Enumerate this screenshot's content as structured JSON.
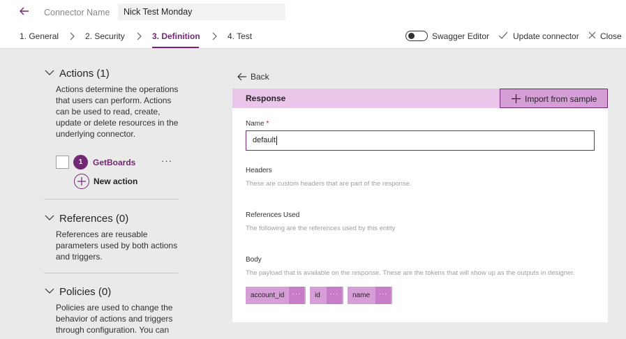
{
  "header": {
    "connector_label": "Connector Name",
    "connector_value": "Nick Test Monday"
  },
  "steps": [
    {
      "label": "1. General"
    },
    {
      "label": "2. Security"
    },
    {
      "label": "3. Definition"
    },
    {
      "label": "4. Test"
    }
  ],
  "toolbar": {
    "swagger_label": "Swagger Editor",
    "swagger_enabled": false,
    "update_label": "Update connector",
    "close_label": "Close"
  },
  "sidebar": {
    "actions": {
      "heading": "Actions (1)",
      "description": "Actions determine the operations that users can perform. Actions can be used to read, create, update or delete resources in the underlying connector.",
      "items": [
        {
          "number": "1",
          "name": "GetBoards",
          "more": "···"
        }
      ],
      "new_action_label": "New action"
    },
    "references": {
      "heading": "References (0)",
      "description": "References are reusable parameters used by both actions and triggers."
    },
    "policies": {
      "heading": "Policies (0)",
      "description": "Policies are used to change the behavior of actions and triggers through configuration. You can"
    }
  },
  "main": {
    "back_label": "Back",
    "card_title": "Response",
    "import_label": "Import from sample",
    "name_label": "Name",
    "required_mark": "*",
    "name_value": "default",
    "headers_label": "Headers",
    "headers_help": "These are custom headers that are part of the response.",
    "refs_label": "References Used",
    "refs_help": "The following are the references used by this entity",
    "body_label": "Body",
    "body_help": "The payload that is available on the response. These are the tokens that will show up as the outputs in designer.",
    "tokens": [
      {
        "label": "account_id",
        "more": "···"
      },
      {
        "label": "id",
        "more": "···"
      },
      {
        "label": "name",
        "more": "···"
      }
    ]
  },
  "colors": {
    "accent": "#742774",
    "header_tint": "#eac7ea",
    "chip": "#d69ed6"
  }
}
